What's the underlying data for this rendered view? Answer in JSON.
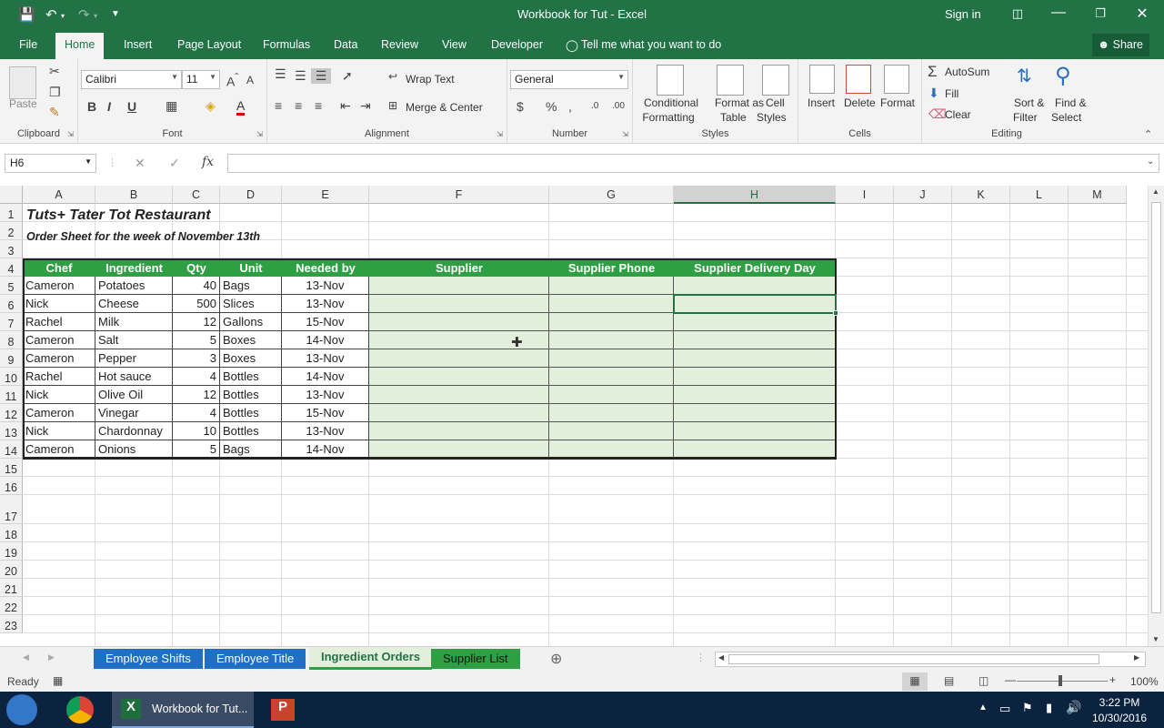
{
  "window": {
    "title": "Workbook for Tut  -  Excel",
    "sign_in": "Sign in"
  },
  "ribbon_tabs": [
    "File",
    "Home",
    "Insert",
    "Page Layout",
    "Formulas",
    "Data",
    "Review",
    "View",
    "Developer"
  ],
  "tell_me": "Tell me what you want to do",
  "share": "Share",
  "ribbon": {
    "clipboard": {
      "label": "Clipboard",
      "paste": "Paste"
    },
    "font": {
      "label": "Font",
      "name": "Calibri",
      "size": "11"
    },
    "alignment": {
      "label": "Alignment",
      "wrap": "Wrap Text",
      "merge": "Merge & Center"
    },
    "number": {
      "label": "Number",
      "format": "General"
    },
    "styles": {
      "label": "Styles",
      "cond1": "Conditional",
      "cond2": "Formatting",
      "fat1": "Format as",
      "fat2": "Table",
      "cs1": "Cell",
      "cs2": "Styles"
    },
    "cells": {
      "label": "Cells",
      "insert": "Insert",
      "delete": "Delete",
      "format": "Format"
    },
    "editing": {
      "label": "Editing",
      "autosum": "AutoSum",
      "fill": "Fill",
      "clear": "Clear",
      "sort1": "Sort &",
      "sort2": "Filter",
      "find1": "Find &",
      "find2": "Select"
    }
  },
  "formula_bar": {
    "name_box": "H6",
    "formula": ""
  },
  "columns": [
    "A",
    "B",
    "C",
    "D",
    "E",
    "F",
    "G",
    "H",
    "I",
    "J",
    "K",
    "L",
    "M"
  ],
  "rows": [
    "1",
    "2",
    "3",
    "4",
    "5",
    "6",
    "7",
    "8",
    "9",
    "10",
    "11",
    "12",
    "13",
    "14",
    "15",
    "16",
    "17",
    "18",
    "19",
    "20",
    "21",
    "22",
    "23"
  ],
  "sheet": {
    "title": "Tuts+ Tater Tot Restaurant",
    "subtitle": "Order Sheet for the week of November 13th",
    "headers": [
      "Chef",
      "Ingredient",
      "Qty",
      "Unit",
      "Needed by",
      "Supplier",
      "Supplier Phone",
      "Supplier Delivery Day"
    ],
    "data": [
      [
        "Cameron",
        "Potatoes",
        "40",
        "Bags",
        "13-Nov"
      ],
      [
        "Nick",
        "Cheese",
        "500",
        "Slices",
        "13-Nov"
      ],
      [
        "Rachel",
        "Milk",
        "12",
        "Gallons",
        "15-Nov"
      ],
      [
        "Cameron",
        "Salt",
        "5",
        "Boxes",
        "14-Nov"
      ],
      [
        "Cameron",
        "Pepper",
        "3",
        "Boxes",
        "13-Nov"
      ],
      [
        "Rachel",
        "Hot sauce",
        "4",
        "Bottles",
        "14-Nov"
      ],
      [
        "Nick",
        "Olive Oil",
        "12",
        "Bottles",
        "13-Nov"
      ],
      [
        "Cameron",
        "Vinegar",
        "4",
        "Bottles",
        "15-Nov"
      ],
      [
        "Nick",
        "Chardonnay",
        "10",
        "Bottles",
        "13-Nov"
      ],
      [
        "Cameron",
        "Onions",
        "5",
        "Bags",
        "14-Nov"
      ]
    ]
  },
  "sheet_tabs": [
    {
      "label": "Employee Shifts",
      "color": "#1f6fc5"
    },
    {
      "label": "Employee Title",
      "color": "#1f6fc5"
    },
    {
      "label": "Ingredient Orders",
      "color": "#e2efda"
    },
    {
      "label": "Supplier List",
      "color": "#2ea043"
    }
  ],
  "status": {
    "ready": "Ready",
    "zoom": "100%"
  },
  "taskbar": {
    "excel_item": "Workbook for Tut...",
    "time": "3:22 PM",
    "date": "10/30/2016"
  }
}
